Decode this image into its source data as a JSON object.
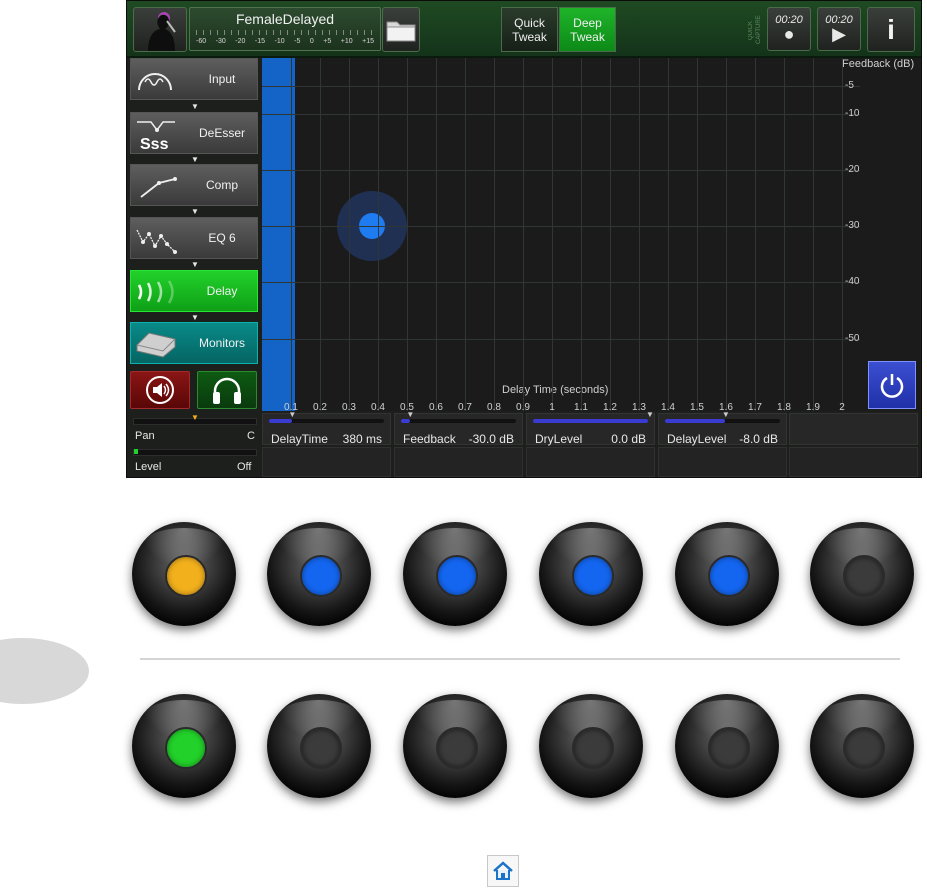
{
  "header": {
    "preset_name": "FemaleDelayed",
    "meter_scale": [
      "-60",
      "-30",
      "-20",
      "-15",
      "-10",
      "-5",
      "0",
      "+5",
      "+10",
      "+15"
    ],
    "quick_tweak": "Quick\nTweak",
    "deep_tweak": "Deep\nTweak",
    "quick_capture_label": "QUICK CAPTURE",
    "record_timer": "00:20",
    "play_timer": "00:20",
    "info_label": "i"
  },
  "modules": [
    {
      "label": "Input",
      "icon": "gauge-icon"
    },
    {
      "label": "DeEsser",
      "icon": "deesser-icon"
    },
    {
      "label": "Comp",
      "icon": "compressor-curve-icon"
    },
    {
      "label": "EQ 6",
      "icon": "eq-icon"
    },
    {
      "label": "Delay",
      "icon": "delay-waves-icon",
      "active": true
    },
    {
      "label": "Monitors",
      "icon": "monitor-speaker-icon"
    }
  ],
  "mixer": {
    "pan_label": "Pan",
    "pan_value": "C",
    "level_label": "Level",
    "level_value": "Off"
  },
  "graph": {
    "y_title": "Feedback (dB)",
    "y_ticks": [
      "-5",
      "-10",
      "-20",
      "-30",
      "-40",
      "-50"
    ],
    "x_title": "Delay Time (seconds)",
    "x_ticks": [
      "0.1",
      "0.2",
      "0.3",
      "0.4",
      "0.5",
      "0.6",
      "0.7",
      "0.8",
      "0.9",
      "1",
      "1.1",
      "1.2",
      "1.3",
      "1.4",
      "1.5",
      "1.6",
      "1.7",
      "1.8",
      "1.9",
      "2"
    ],
    "point": {
      "delay_time_s": 0.38,
      "feedback_db": -30
    }
  },
  "params": [
    {
      "name": "DelayTime",
      "value": "380 ms",
      "fill": 0.2
    },
    {
      "name": "Feedback",
      "value": "-30.0 dB",
      "fill": 0.08
    },
    {
      "name": "DryLevel",
      "value": "0.0 dB",
      "fill": 1.0
    },
    {
      "name": "DelayLevel",
      "value": "-8.0 dB",
      "fill": 0.52
    }
  ],
  "colors": {
    "knob_1": "#f2b01d",
    "knob_2": "#1466f0",
    "knob_3": "#1466f0",
    "knob_4": "#1466f0",
    "knob_5": "#1466f0",
    "knob_7": "#22d12a"
  },
  "icons": {
    "folder": "folder-icon",
    "singer": "singer-avatar-icon",
    "mute": "speaker-mute-icon",
    "headphones": "headphones-icon",
    "power": "power-icon",
    "home": "home-icon"
  }
}
